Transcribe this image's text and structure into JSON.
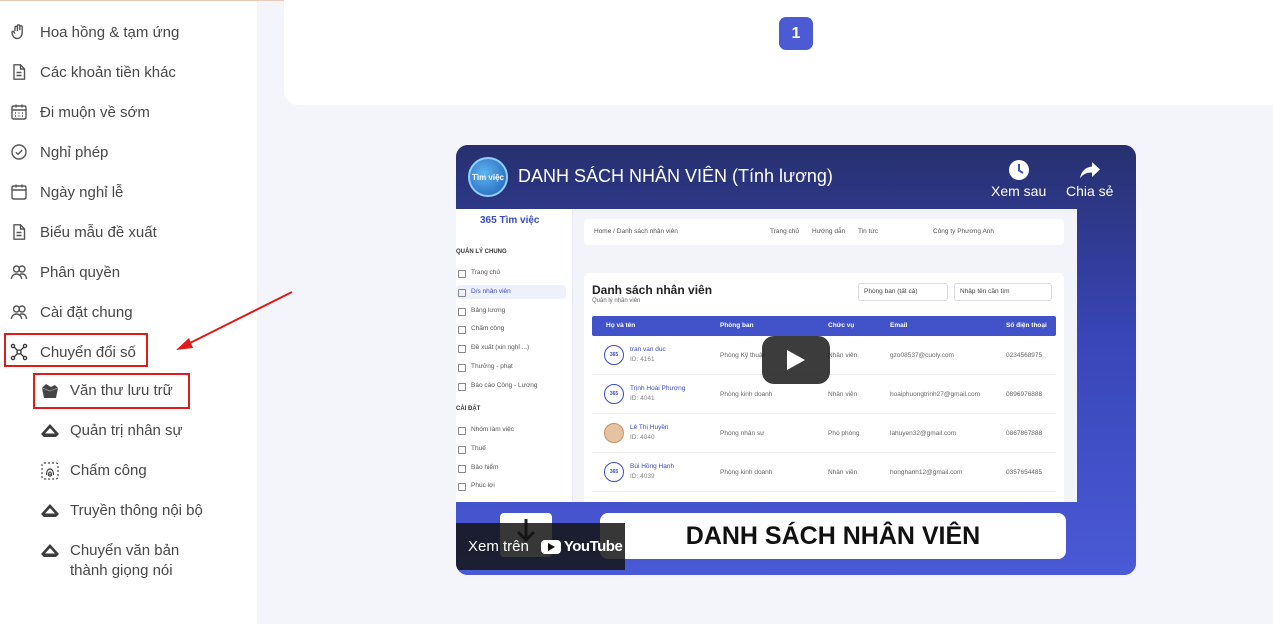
{
  "sidebar": {
    "items": [
      {
        "label": "Hoa hồng & tạm ứng",
        "icon": "hand-icon"
      },
      {
        "label": "Các khoản tiền khác",
        "icon": "document-icon"
      },
      {
        "label": "Đi muộn về sớm",
        "icon": "calendar-grid-icon"
      },
      {
        "label": "Nghỉ phép",
        "icon": "check-circle-icon"
      },
      {
        "label": "Ngày nghỉ lễ",
        "icon": "calendar-icon"
      },
      {
        "label": "Biểu mẫu đề xuất",
        "icon": "form-icon"
      },
      {
        "label": "Phân quyền",
        "icon": "users-icon"
      },
      {
        "label": "Cài đặt chung",
        "icon": "users-settings-icon"
      },
      {
        "label": "Chuyển đổi số",
        "icon": "network-icon"
      }
    ],
    "subitems": [
      {
        "label": "Văn thư lưu trữ",
        "icon": "archive-icon"
      },
      {
        "label": "Quản trị nhân sự",
        "icon": "app-logo-icon"
      },
      {
        "label": "Chấm công",
        "icon": "fingerprint-icon"
      },
      {
        "label": "Truyền thông nội bộ",
        "icon": "app-logo-icon"
      },
      {
        "label": "Chuyển văn bản thành giọng nói",
        "icon": "app-logo-icon"
      }
    ]
  },
  "pagination": {
    "current_page": "1"
  },
  "video": {
    "title": "DANH SÁCH NHÂN VIÊN (Tính lương)",
    "watch_later": "Xem sau",
    "share": "Chia sẻ",
    "watch_on": "Xem trên",
    "youtube": "YouTube",
    "banner_text": "DANH SÁCH NHÂN VIÊN",
    "channel_avatar_text": "Tìm việc"
  },
  "embedded": {
    "logo": "365 Tìm việc",
    "section_general": "QUẢN LÝ CHUNG",
    "links_general": [
      "Trang chủ",
      "D/s nhân viên",
      "Bảng lương",
      "Chấm công",
      "Đề xuất (xin nghỉ ...)",
      "Thưởng - phạt",
      "Báo cáo Công - Lương"
    ],
    "section_settings": "CÀI ĐẶT",
    "links_settings": [
      "Nhóm làm việc",
      "Thuế",
      "Bảo hiểm",
      "Phúc lợi"
    ],
    "breadcrumb": "Home / Danh sách nhân viên",
    "top_links": [
      "Trang chủ",
      "Hướng dẫn",
      "Tin tức"
    ],
    "company": "Công ty Phương Anh",
    "panel_title": "Danh sách nhân viên",
    "panel_subtitle": "Quản lý nhân viên",
    "filter_department": "Phòng ban (tất cả)",
    "filter_search": "Nhập tên cần tìm",
    "columns": [
      "Họ và tên",
      "Phòng ban",
      "Chức vụ",
      "Email",
      "Số điện thoại"
    ],
    "rows": [
      {
        "name": "tran van duc",
        "id": "ID: 4161",
        "department": "Phòng Kỹ thuật",
        "position": "Nhân viên",
        "email": "gzo08537@cuoly.com",
        "phone": "0234568975"
      },
      {
        "name": "Trịnh Hoài Phương",
        "id": "ID: 4041",
        "department": "Phòng kinh doanh",
        "position": "Nhân viên",
        "email": "hoaiphuongtrinh27@gmail.com",
        "phone": "0896976888"
      },
      {
        "name": "Lê Thị Huyền",
        "id": "ID: 4040",
        "department": "Phòng nhân sự",
        "position": "Phó phòng",
        "email": "lahuyen32@gmail.com",
        "phone": "0867867888"
      },
      {
        "name": "Bùi Hồng Hạnh",
        "id": "ID: 4039",
        "department": "Phòng kinh doanh",
        "position": "Nhân viên",
        "email": "honghanh12@gmail.com",
        "phone": "0357654485"
      }
    ]
  },
  "colors": {
    "highlight": "#e01b1b",
    "accent": "#4c5bd4"
  }
}
